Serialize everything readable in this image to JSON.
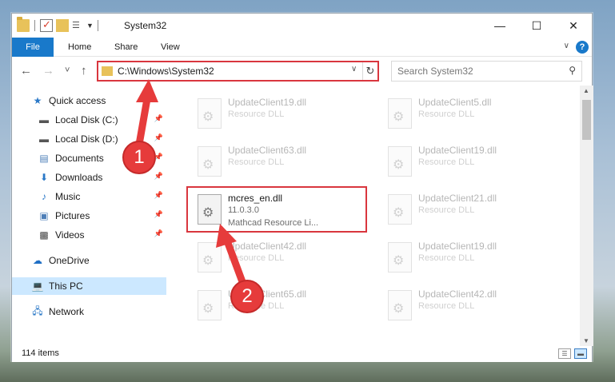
{
  "window": {
    "title": "System32",
    "buttons": {
      "minimize": "—",
      "maximize": "☐",
      "close": "✕"
    }
  },
  "ribbon": {
    "tabs": [
      "File",
      "Home",
      "Share",
      "View"
    ],
    "help": "?"
  },
  "navigation": {
    "back": "←",
    "forward": "→",
    "recent": "˅",
    "up": "↑",
    "address": "C:\\Windows\\System32",
    "search_placeholder": "Search System32"
  },
  "sidebar": {
    "items": [
      {
        "label": "Quick access",
        "icon": "star-icon"
      },
      {
        "label": "Local Disk (C:)",
        "icon": "drive-icon",
        "pinned": true
      },
      {
        "label": "Local Disk (D:)",
        "icon": "drive-icon",
        "pinned": true
      },
      {
        "label": "Documents",
        "icon": "documents-icon",
        "pinned": true
      },
      {
        "label": "Downloads",
        "icon": "downloads-icon",
        "pinned": true
      },
      {
        "label": "Music",
        "icon": "music-icon",
        "pinned": true
      },
      {
        "label": "Pictures",
        "icon": "pictures-icon",
        "pinned": true
      },
      {
        "label": "Videos",
        "icon": "videos-icon",
        "pinned": true
      },
      {
        "label": "OneDrive",
        "icon": "cloud-icon"
      },
      {
        "label": "This PC",
        "icon": "computer-icon",
        "selected": true
      },
      {
        "label": "Network",
        "icon": "network-icon"
      }
    ]
  },
  "files": [
    {
      "name": "UpdateClient19.dll",
      "line2": "Resource DLL",
      "line3": "",
      "faded": true
    },
    {
      "name": "UpdateClient5.dll",
      "line2": "Resource DLL",
      "line3": "",
      "faded": true
    },
    {
      "name": "UpdateClient63.dll",
      "line2": "Resource DLL",
      "line3": "",
      "faded": true
    },
    {
      "name": "UpdateClient19.dll",
      "line2": "Resource DLL",
      "line3": "",
      "faded": true
    },
    {
      "name": "mcres_en.dll",
      "line2": "11.0.3.0",
      "line3": "Mathcad Resource Li...",
      "faded": false
    },
    {
      "name": "UpdateClient21.dll",
      "line2": "Resource DLL",
      "line3": "",
      "faded": true
    },
    {
      "name": "UpdateClient42.dll",
      "line2": "Resource DLL",
      "line3": "",
      "faded": true
    },
    {
      "name": "UpdateClient19.dll",
      "line2": "Resource DLL",
      "line3": "",
      "faded": true
    },
    {
      "name": "UpdateClient65.dll",
      "line2": "Resource DLL",
      "line3": "",
      "faded": true
    },
    {
      "name": "UpdateClient42.dll",
      "line2": "Resource DLL",
      "line3": "",
      "faded": true
    }
  ],
  "status": {
    "item_count": "114 items"
  },
  "annotations": {
    "step1": "1",
    "step2": "2",
    "color": "#e63b3b"
  }
}
